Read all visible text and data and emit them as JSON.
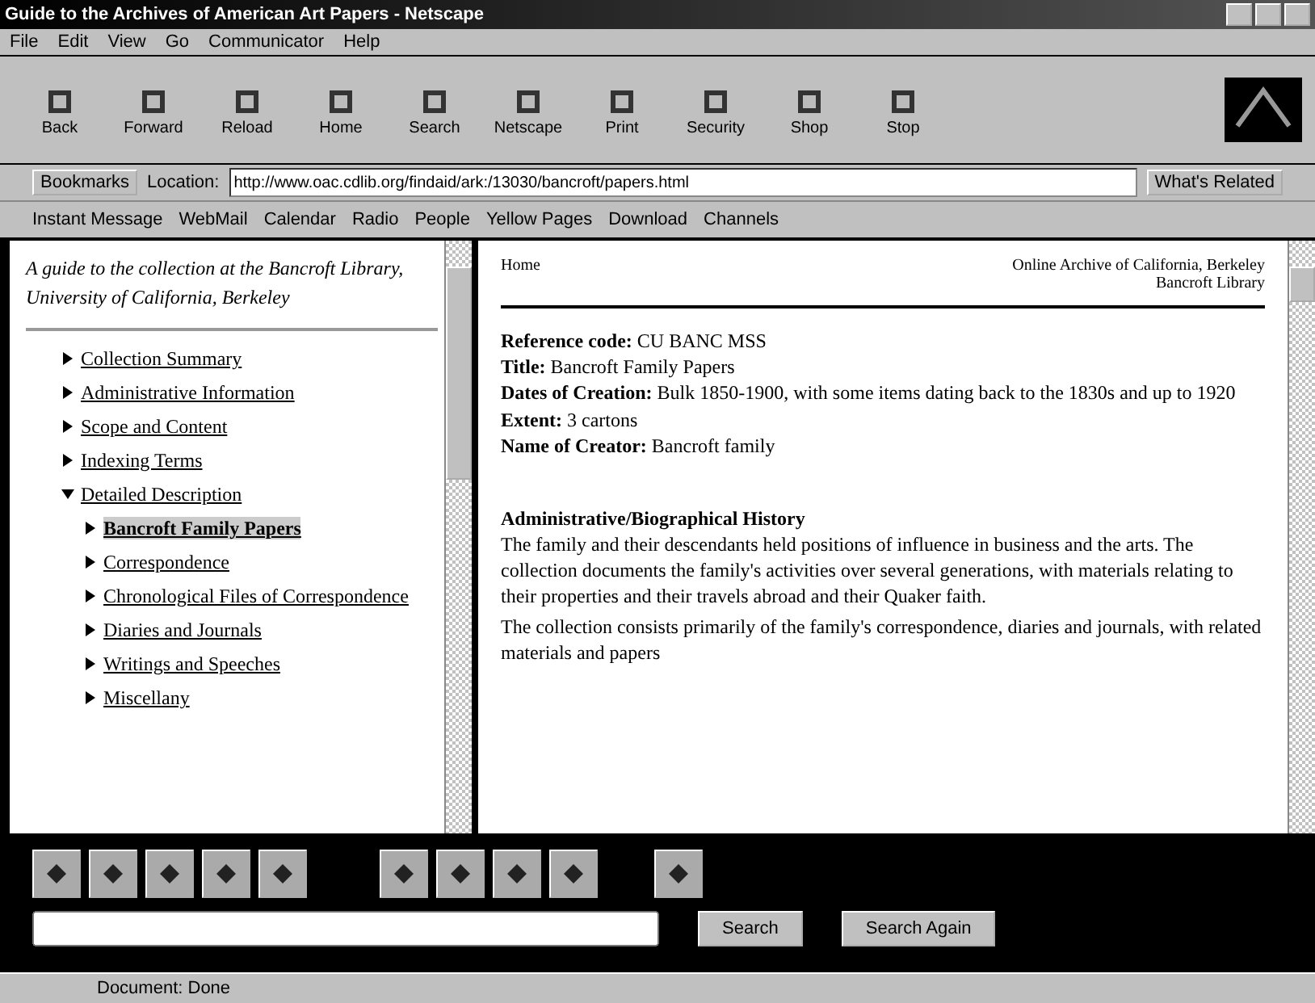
{
  "window": {
    "title": "Guide to the Archives of American Art Papers - Netscape"
  },
  "menu": [
    "File",
    "Edit",
    "View",
    "Go",
    "Communicator",
    "Help"
  ],
  "toolbar": [
    {
      "label": "Back"
    },
    {
      "label": "Forward"
    },
    {
      "label": "Reload"
    },
    {
      "label": "Home"
    },
    {
      "label": "Search"
    },
    {
      "label": "Netscape"
    },
    {
      "label": "Print"
    },
    {
      "label": "Security"
    },
    {
      "label": "Shop"
    },
    {
      "label": "Stop"
    }
  ],
  "location": {
    "bookmarks": "Bookmarks",
    "label": "Location:",
    "value": "http://www.oac.cdlib.org/findaid/ark:/13030/bancroft/papers.html",
    "related": "What's Related"
  },
  "personal": [
    "Instant Message",
    "WebMail",
    "Calendar",
    "Radio",
    "People",
    "Yellow Pages",
    "Download",
    "Channels"
  ],
  "toc": {
    "intro": "A guide to the collection at the Bancroft Library, University of California, Berkeley",
    "items": [
      {
        "label": "Collection Summary",
        "expanded": false
      },
      {
        "label": "Administrative Information",
        "expanded": false
      },
      {
        "label": "Scope and Content",
        "expanded": false
      },
      {
        "label": "Indexing Terms",
        "expanded": false
      },
      {
        "label": "Detailed Description",
        "expanded": true,
        "children": [
          {
            "label": "Bancroft Family Papers",
            "selected": true
          },
          {
            "label": "Correspondence",
            "selected": false
          },
          {
            "label": "Chronological Files of Correspondence",
            "selected": false
          },
          {
            "label": "Diaries and Journals",
            "selected": false
          },
          {
            "label": "Writings and Speeches",
            "selected": false
          },
          {
            "label": "Miscellany",
            "selected": false
          }
        ]
      }
    ]
  },
  "document": {
    "corner": "Home",
    "header": [
      "Online Archive of California, Berkeley",
      "Bancroft Library"
    ],
    "fields": [
      {
        "label": "Reference code:",
        "value": "CU BANC MSS"
      },
      {
        "label": "Title:",
        "value": "Bancroft Family Papers"
      },
      {
        "label": "Dates of Creation:",
        "value": "Bulk 1850-1900, with some items dating back to the 1830s and up to 1920"
      },
      {
        "label": "Extent:",
        "value": "3 cartons"
      },
      {
        "label": "Name of Creator:",
        "value": "Bancroft family"
      }
    ],
    "section": "Administrative/Biographical History",
    "paragraphs": [
      "The family and their descendants held positions of influence in business and the arts. The collection documents the family's activities over several generations, with materials relating to their properties and their travels abroad and their Quaker faith.",
      "The collection consists primarily of the family's correspondence, diaries and journals, with related materials and papers"
    ]
  },
  "bottom": {
    "buttons": [
      "Search",
      "Search Again"
    ]
  },
  "status": "Document: Done"
}
